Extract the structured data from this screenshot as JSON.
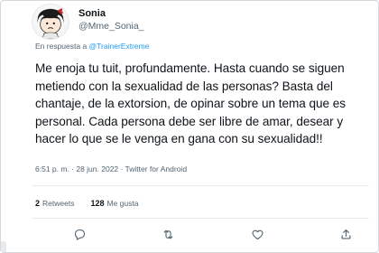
{
  "user": {
    "display_name": "Sonia",
    "handle": "@Mme_Sonia_",
    "avatar_icon": "mafalda-avatar-icon"
  },
  "reply": {
    "prefix": "En respuesta a ",
    "mention": "@TrainerExtreme"
  },
  "tweet": {
    "text": "Me enoja tu tuit, profundamente. Hasta cuando se siguen metiendo con la sexualidad de las personas? Basta del chantaje, de la extorsion, de opinar sobre un tema que es personal. Cada persona debe ser libre de amar, desear y hacer lo que se le venga en gana con su sexualidad!!"
  },
  "meta": {
    "timestamp": "6:51 p. m. · 28 jun. 2022 · Twitter for Android"
  },
  "stats": {
    "retweets_count": "2",
    "retweets_label": "Retweets",
    "likes_count": "128",
    "likes_label": "Me gusta"
  },
  "actions": {
    "icons": [
      "reply-icon",
      "retweet-icon",
      "like-icon",
      "share-icon"
    ]
  },
  "colors": {
    "accent": "#1d9bf0",
    "text": "#0f1419",
    "muted": "#536471",
    "border": "#d4d9dd"
  }
}
